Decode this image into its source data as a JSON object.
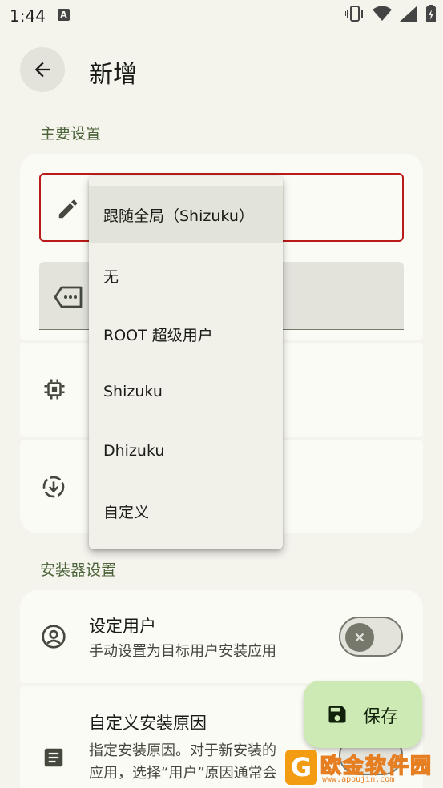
{
  "status_bar": {
    "time": "1:44",
    "notification_badge": "A"
  },
  "header": {
    "title": "新增"
  },
  "sections": {
    "main": "主要设置",
    "installer": "安装器设置"
  },
  "dropdown_menu": {
    "items": [
      {
        "label": "跟随全局（Shizuku）",
        "selected": true
      },
      {
        "label": "无",
        "selected": false
      },
      {
        "label": "ROOT 超级用户",
        "selected": false
      },
      {
        "label": "Shizuku",
        "selected": false
      },
      {
        "label": "Dhizuku",
        "selected": false
      },
      {
        "label": "自定义",
        "selected": false
      }
    ]
  },
  "settings": {
    "set_user": {
      "title": "设定用户",
      "subtitle": "手动设置为目标用户安装应用",
      "enabled": false
    },
    "install_reason": {
      "title": "自定义安装原因",
      "subtitle_line1": "指定安装原因。对于新安装的",
      "subtitle_line2": "应用，选择“用户”原因通常会"
    }
  },
  "fab": {
    "label": "保存"
  },
  "watermark": {
    "brand": "欧金软件园",
    "url": "www.apoujin.com",
    "logo_letter": "G"
  },
  "colors": {
    "accent": "#4c6339",
    "error": "#ba1a1a",
    "fab_bg": "#cdeab4",
    "background": "#f4f3ec"
  }
}
